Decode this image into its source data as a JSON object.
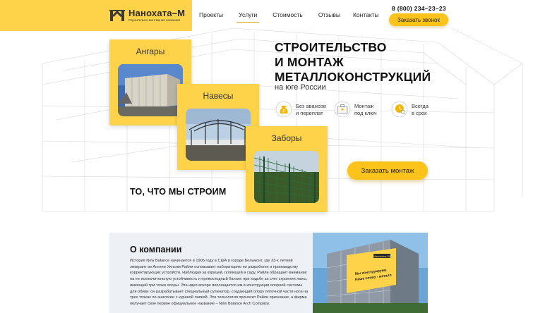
{
  "header": {
    "logo_name": "Нанохата–М",
    "logo_tagline": "Строительно-монтажная компания",
    "nav": [
      {
        "label": "Проекты",
        "active": false
      },
      {
        "label": "Услуги",
        "active": true
      },
      {
        "label": "Стоимость",
        "active": false
      },
      {
        "label": "Отзывы",
        "active": false
      },
      {
        "label": "Контакты",
        "active": false
      }
    ],
    "phone": "8 (800) 234–23–23",
    "call_button": "Заказать звонок"
  },
  "cards": [
    {
      "title": "Ангары",
      "photo": "hangar-photo"
    },
    {
      "title": "Навесы",
      "photo": "canopy-photo"
    },
    {
      "title": "Заборы",
      "photo": "fence-photo"
    }
  ],
  "hero": {
    "title_line1": "СТРОИТЕЛЬСТВО",
    "title_line2": "И МОНТАЖ",
    "title_line3": "МЕТАЛЛОКОНСТРУКЦИЙ",
    "subtitle": "на юге России",
    "features": [
      {
        "icon": "money-bag-icon",
        "line1": "Без авансов",
        "line2": "и переплат"
      },
      {
        "icon": "briefcase-icon",
        "line1": "Монтаж",
        "line2": "под ключ"
      },
      {
        "icon": "clock-icon",
        "line1": "Всегда",
        "line2": "в срок"
      }
    ],
    "order_button": "Заказать монтаж"
  },
  "what_we_build": "ТО, ЧТО МЫ СТРОИМ",
  "about": {
    "title": "О компании",
    "text": "История New Balance начинается в 1906 году в США в городе Бельмонт, где 33-х летний эмигрант из Англии Уильям Райли основывает лабораторию по разработке и производству корректирующих устройств. Наблюдая за курицей, гуляющей в саду, Райли обращает внимание на ее исключительную устойчивость и превосходный баланс при ходьбе за счет строения лапы, имеющей три точки опоры. Эта идея вскоре воплощается им в конструкции опорной системы для обуви: он разрабатывает специальный супинатор, создающий опору пяточной части ноги на трех точках по аналогии с куриной лапкой. Эта технология приносит Райли признание, а фирма получает свое первое официальное название – New Balance Arch Company.",
    "banner_logo": "Нанохата–М",
    "banner_slogan_line1": "Мы конструируем.",
    "banner_slogan_line2": "Наше слово - металл"
  },
  "colors": {
    "accent": "#fed34a",
    "button": "#fcc31b",
    "about_bg": "#edf0f5"
  }
}
